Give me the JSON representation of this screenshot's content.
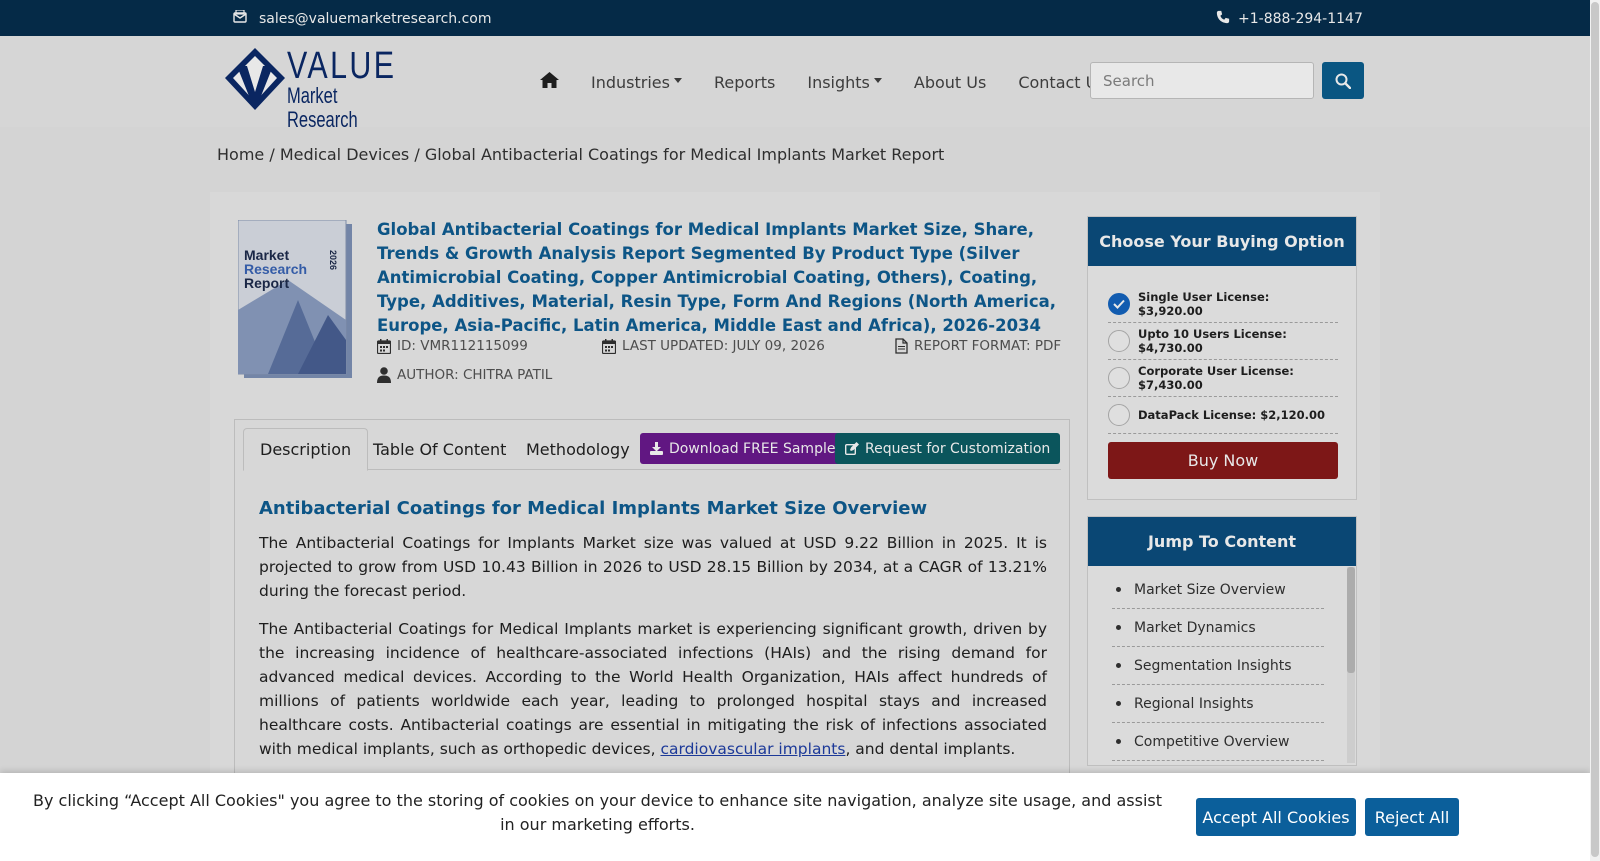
{
  "topbar": {
    "email": "sales@valuemarketresearch.com",
    "phone": "+1-888-294-1147"
  },
  "logo": {
    "line1": "VALUE",
    "line2": "Market Research"
  },
  "nav": {
    "items": [
      {
        "label": "Industries",
        "dropdown": true
      },
      {
        "label": "Reports",
        "dropdown": false
      },
      {
        "label": "Insights",
        "dropdown": true
      },
      {
        "label": "About Us",
        "dropdown": false
      },
      {
        "label": "Contact Us",
        "dropdown": false
      }
    ],
    "search_placeholder": "Search"
  },
  "breadcrumb": "Home / Medical Devices / Global Antibacterial Coatings for Medical Implants Market Report",
  "cover": {
    "line1": "Market",
    "line2": "Research",
    "line3": "Report",
    "year": "2026"
  },
  "report": {
    "title": "Global Antibacterial Coatings for Medical Implants Market Size, Share, Trends & Growth Analysis Report Segmented By Product Type (Silver Antimicrobial Coating, Copper Antimicrobial Coating, Others), Coating, Type, Additives, Material, Resin Type, Form And Regions (North America, Europe, Asia-Pacific, Latin America, Middle East and Africa), 2026-2034",
    "id": "ID: VMR112115099",
    "updated": "LAST UPDATED: JULY 09, 2026",
    "format": "REPORT FORMAT: PDF",
    "author": "AUTHOR: CHITRA PATIL"
  },
  "tabs": {
    "description": "Description",
    "toc": "Table Of Content",
    "methodology": "Methodology",
    "sample": "Download FREE Sample",
    "customization": "Request for Customization"
  },
  "content": {
    "heading": "Antibacterial Coatings for Medical Implants Market Size Overview",
    "p1": "The Antibacterial Coatings for Implants Market size was valued at USD 9.22 Billion in 2025. It is projected to grow from USD 10.43 Billion in 2026 to USD 28.15 Billion by 2034, at a CAGR of 13.21% during the forecast period.",
    "p2_before": "The Antibacterial Coatings for Medical Implants market is experiencing significant growth, driven by the increasing incidence of healthcare-associated infections (HAIs) and the rising demand for advanced medical devices. According to the World Health Organization, HAIs affect hundreds of millions of patients worldwide each year, leading to prolonged hospital stays and increased healthcare costs. Antibacterial coatings are essential in mitigating the risk of infections associated with medical implants, such as orthopedic devices, ",
    "p2_link": "cardiovascular implants",
    "p2_after": ", and dental implants."
  },
  "buying": {
    "header": "Choose Your Buying Option",
    "options": [
      {
        "label": "Single User License: $3,920.00",
        "selected": true
      },
      {
        "label": "Upto 10 Users License: $4,730.00",
        "selected": false
      },
      {
        "label": "Corporate User License: $7,430.00",
        "selected": false
      },
      {
        "label": "DataPack License: $2,120.00",
        "selected": false
      }
    ],
    "buy_label": "Buy Now"
  },
  "jump": {
    "header": "Jump To Content",
    "items": [
      "Market Size Overview",
      "Market Dynamics",
      "Segmentation Insights",
      "Regional Insights",
      "Competitive Overview"
    ]
  },
  "cookie": {
    "text": "By clicking “Accept All Cookies\" you agree to the storing of cookies on your device to enhance site navigation, analyze site usage, and assist in our marketing efforts.",
    "accept": "Accept All Cookies",
    "reject": "Reject All"
  },
  "colors": {
    "topbar": "#062f4f",
    "brand_blue": "#0f5e94",
    "sample_button": "#6b1a8f",
    "custom_button": "#0d5e66",
    "buy_button": "#8a1a1a",
    "cookie_button": "#0b5f9b"
  }
}
